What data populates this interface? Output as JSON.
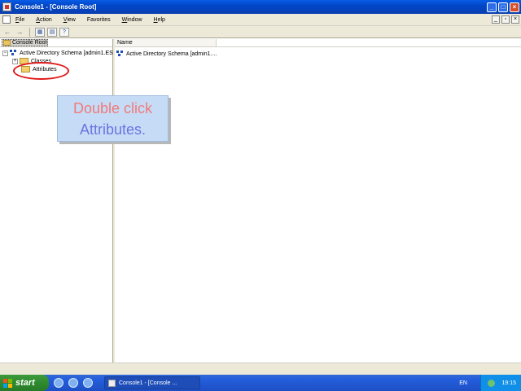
{
  "window": {
    "title": "Console1 - [Console Root]"
  },
  "menu": {
    "items": [
      {
        "accel": "F",
        "rest": "ile"
      },
      {
        "accel": "A",
        "rest": "ction"
      },
      {
        "accel": "V",
        "rest": "iew"
      },
      {
        "accel": "F",
        "rest": "avorites",
        "prefix": ""
      },
      {
        "accel": "W",
        "rest": "indow"
      },
      {
        "accel": "H",
        "rest": "elp"
      }
    ]
  },
  "tree": {
    "root_label": "Console Root",
    "ad_node_label": "Active Directory Schema [admin1.ES-",
    "classes_label": "Classes",
    "attributes_label": "Attributes"
  },
  "list": {
    "column_name": "Name",
    "rows": [
      "Active Directory Schema [admin1...."
    ]
  },
  "instruction": {
    "line1": "Double click",
    "line2": "Attributes."
  },
  "taskbar": {
    "start_label": "start",
    "task_label": "Console1 - [Console ...",
    "language": "EN",
    "clock": "19:15"
  },
  "colors": {
    "title_bar": "#0a5ce6",
    "highlight_ellipse": "#e01818",
    "instruction_bg": "#c6dcf6",
    "instruction_line1": "#f07a7a",
    "instruction_line2": "#6a75e0"
  }
}
